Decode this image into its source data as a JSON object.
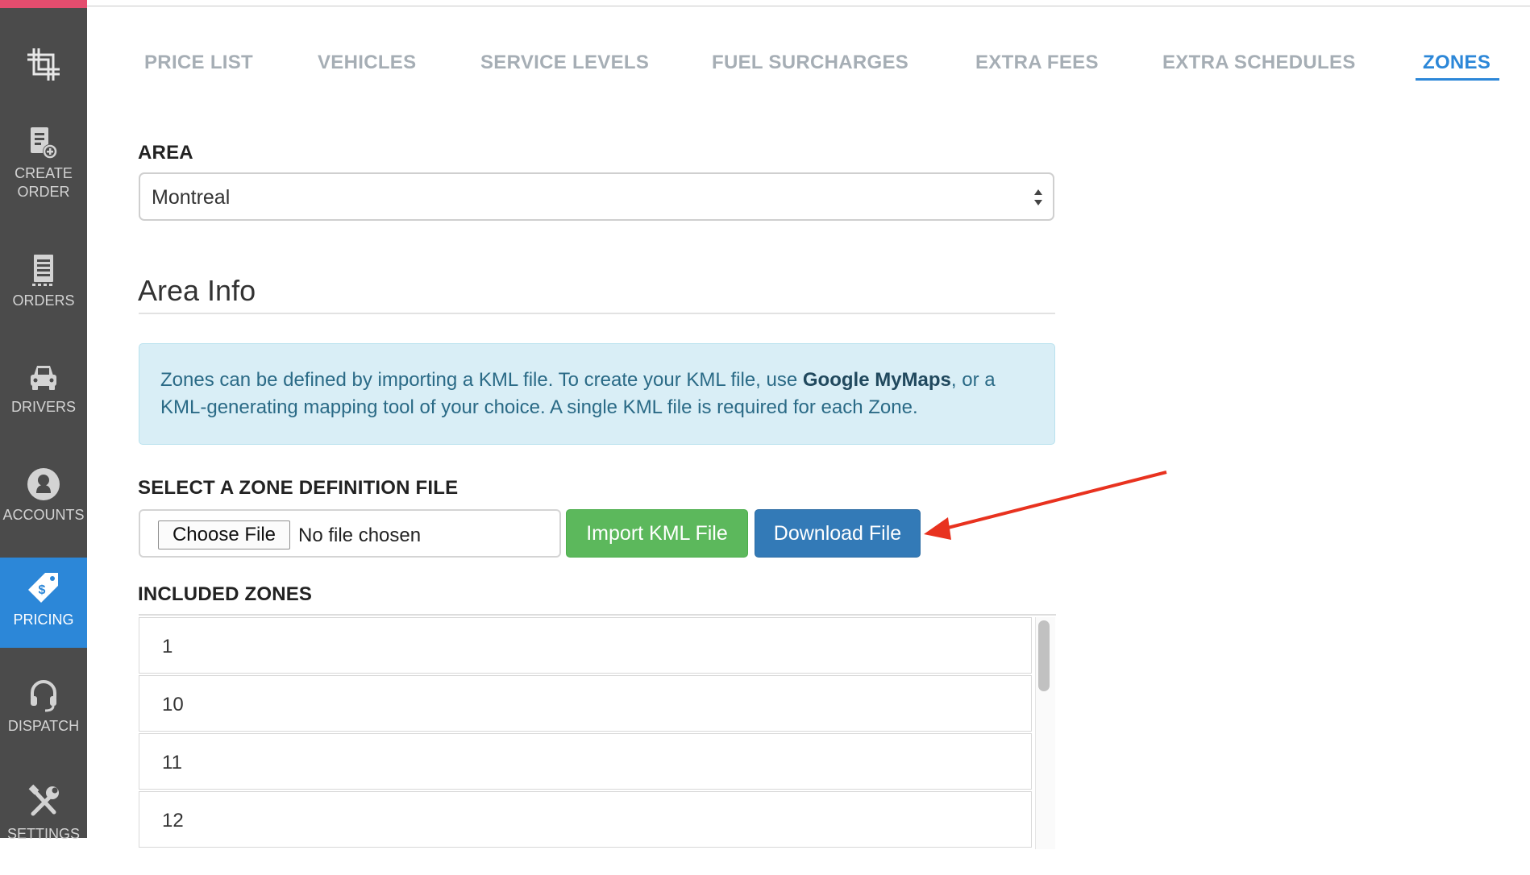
{
  "sidebar": {
    "items": [
      {
        "label_line1": "CREATE",
        "label_line2": "ORDER",
        "icon": "create-order-icon"
      },
      {
        "label_line1": "ORDERS",
        "label_line2": "",
        "icon": "orders-icon"
      },
      {
        "label_line1": "DRIVERS",
        "label_line2": "",
        "icon": "car-icon"
      },
      {
        "label_line1": "ACCOUNTS",
        "label_line2": "",
        "icon": "user-icon"
      },
      {
        "label_line1": "PRICING",
        "label_line2": "",
        "icon": "price-tag-icon",
        "active": true
      },
      {
        "label_line1": "DISPATCH",
        "label_line2": "",
        "icon": "headset-icon"
      },
      {
        "label_line1": "SETTINGS",
        "label_line2": "",
        "icon": "tools-icon"
      }
    ],
    "colors": {
      "bg": "#4b4b4b",
      "active": "#2c87d8",
      "accent": "#e44d6e"
    }
  },
  "tabs": [
    {
      "label": "PRICE LIST"
    },
    {
      "label": "VEHICLES"
    },
    {
      "label": "SERVICE LEVELS"
    },
    {
      "label": "FUEL SURCHARGES"
    },
    {
      "label": "EXTRA FEES"
    },
    {
      "label": "EXTRA SCHEDULES"
    },
    {
      "label": "ZONES",
      "active": true
    }
  ],
  "area": {
    "label": "AREA",
    "selected": "Montreal"
  },
  "area_info": {
    "title": "Area Info",
    "text_before": "Zones can be defined by importing a KML file. To create your KML file, use ",
    "text_bold": "Google MyMaps",
    "text_after": ", or a KML-generating mapping tool of your choice. A single KML file is required for each Zone."
  },
  "zone_file": {
    "label": "SELECT A ZONE DEFINITION FILE",
    "choose_label": "Choose File",
    "no_file": "No file chosen",
    "import_label": "Import KML File",
    "download_label": "Download File"
  },
  "included_zones": {
    "label": "INCLUDED ZONES",
    "items": [
      "1",
      "10",
      "11",
      "12"
    ]
  },
  "colors": {
    "primary": "#337ab7",
    "success": "#5cb85c",
    "info_bg": "#d9eef6",
    "annotation": "#e8321f"
  }
}
